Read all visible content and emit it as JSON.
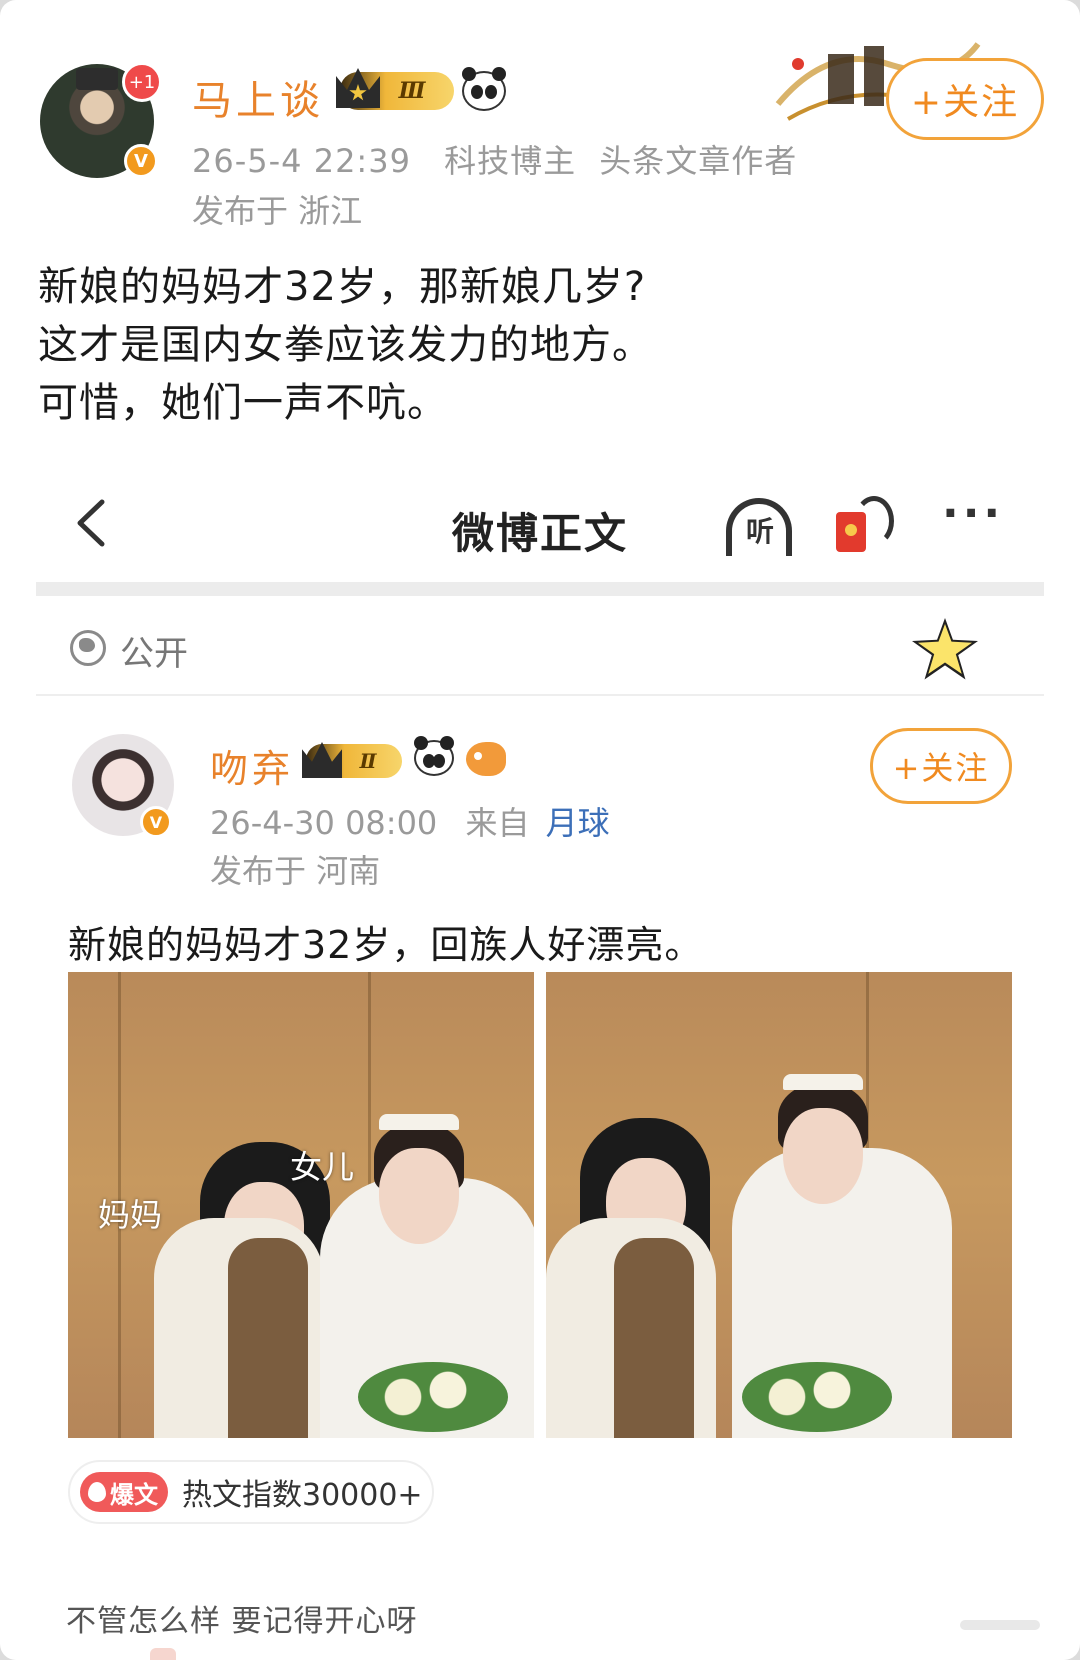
{
  "author": {
    "name": "马上谈",
    "avatar_badge": "+1",
    "verified_badge": "V",
    "level_badge": "Ⅲ",
    "timestamp": "26-5-4 22:39",
    "tags": [
      "科技博主",
      "头条文章作者"
    ],
    "location": "发布于 浙江",
    "follow_label": "+关注"
  },
  "post": {
    "lines": [
      "新娘的妈妈才32岁，那新娘几岁?",
      "这才是国内女拳应该发力的地方。",
      "可惜，她们一声不吭。"
    ]
  },
  "embedded": {
    "nav": {
      "title": "微博正文",
      "listen_label": "听",
      "more_label": "···"
    },
    "visibility": "公开",
    "author": {
      "name": "吻弃",
      "verified_badge": "V",
      "level_badge": "Ⅱ",
      "timestamp": "26-4-30 08:00",
      "source_prefix": "来自",
      "source": "月球",
      "location": "发布于 河南",
      "follow_label": "+关注"
    },
    "text": "新娘的妈妈才32岁，回族人好漂亮。",
    "photos": [
      {
        "labels": {
          "mom": "妈妈",
          "daughter": "女儿"
        }
      },
      {
        "labels": {}
      }
    ],
    "hot": {
      "tag": "爆文",
      "text": "热文指数30000+"
    },
    "comment": "不管怎么样 要记得开心呀"
  },
  "colors": {
    "accent_orange": "#f08a20",
    "name_orange": "#e8822b",
    "link_blue": "#3c6fb8",
    "hot_red": "#f05a5a"
  }
}
